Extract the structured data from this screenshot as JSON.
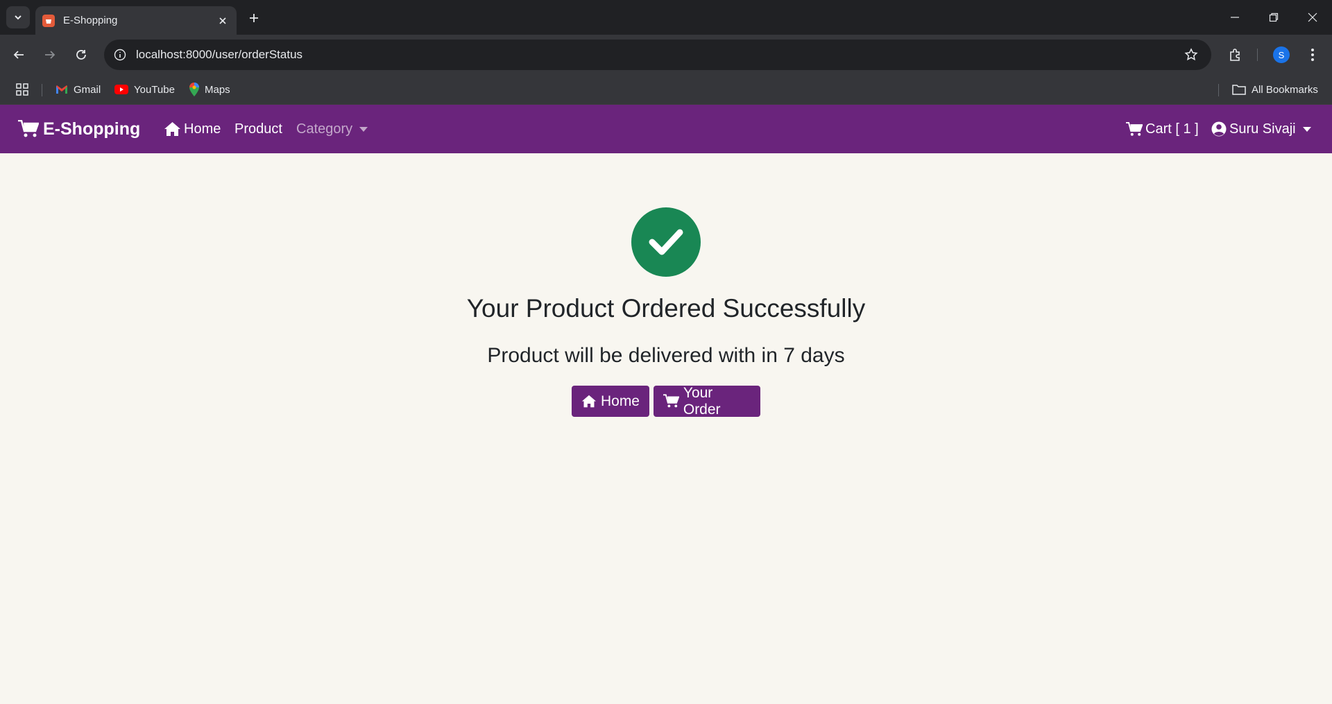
{
  "browser": {
    "tab_title": "E-Shopping",
    "url": "localhost:8000/user/orderStatus",
    "profile_initial": "S",
    "bookmarks": [
      {
        "label": "Gmail",
        "icon": "gmail-icon"
      },
      {
        "label": "YouTube",
        "icon": "youtube-icon"
      },
      {
        "label": "Maps",
        "icon": "maps-icon"
      }
    ],
    "all_bookmarks_label": "All Bookmarks"
  },
  "navbar": {
    "brand": "E-Shopping",
    "home": "Home",
    "product": "Product",
    "category": "Category",
    "cart": "Cart [ 1 ]",
    "user": "Suru Sivaji",
    "color": "#6a247c"
  },
  "order_status": {
    "title": "Your Product Ordered Successfully",
    "message": "Product will be delivered with in 7 days",
    "home_button": "Home",
    "order_button": "Your Order",
    "success_color": "#198754"
  }
}
